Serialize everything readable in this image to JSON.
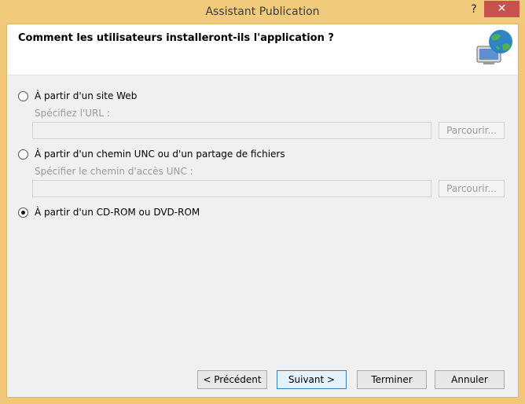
{
  "window": {
    "title": "Assistant Publication",
    "help": "?",
    "close": "✕"
  },
  "header": {
    "question": "Comment les utilisateurs installeront-ils l'application ?",
    "icon": "globe-computer-icon"
  },
  "options": [
    {
      "label": "À partir d'un site Web",
      "selected": false,
      "field_label": "Spécifiez l'URL :",
      "field_value": "",
      "browse_label": "Parcourir..."
    },
    {
      "label": "À partir d'un chemin UNC ou d'un partage de fichiers",
      "selected": false,
      "field_label": "Spécifier le chemin d'accès UNC :",
      "field_value": "",
      "browse_label": "Parcourir..."
    },
    {
      "label": "À partir d'un CD-ROM ou DVD-ROM",
      "selected": true
    }
  ],
  "footer": {
    "previous": "< Précédent",
    "next": "Suivant >",
    "finish": "Terminer",
    "cancel": "Annuler"
  },
  "colors": {
    "title_bar": "#f2ca7c",
    "close_button": "#c7514d",
    "client_background": "#f0f0f0"
  }
}
